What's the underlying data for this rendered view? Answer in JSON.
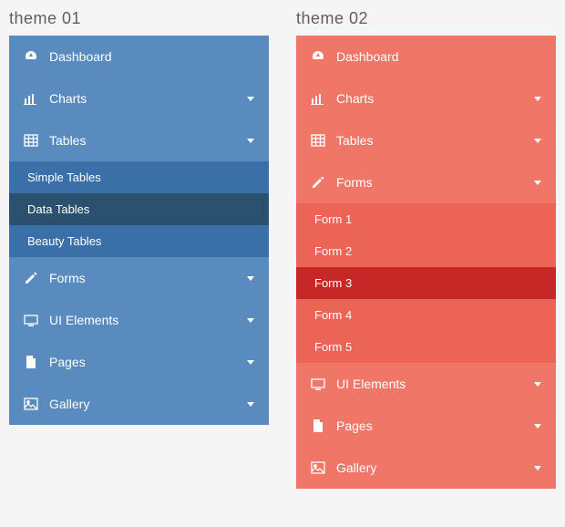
{
  "themes": [
    {
      "id": "theme-01",
      "title": "theme 01",
      "color": "blue",
      "items": [
        {
          "icon": "dashboard",
          "label": "Dashboard",
          "children": false
        },
        {
          "icon": "charts",
          "label": "Charts",
          "children": true
        },
        {
          "icon": "tables",
          "label": "Tables",
          "children": true,
          "sub": [
            {
              "label": "Simple Tables",
              "active": false
            },
            {
              "label": "Data Tables",
              "active": true
            },
            {
              "label": "Beauty Tables",
              "active": false
            }
          ]
        },
        {
          "icon": "forms",
          "label": "Forms",
          "children": true
        },
        {
          "icon": "ui",
          "label": "UI Elements",
          "children": true
        },
        {
          "icon": "pages",
          "label": "Pages",
          "children": true
        },
        {
          "icon": "gallery",
          "label": "Gallery",
          "children": true
        }
      ]
    },
    {
      "id": "theme-02",
      "title": "theme 02",
      "color": "red",
      "items": [
        {
          "icon": "dashboard",
          "label": "Dashboard",
          "children": false
        },
        {
          "icon": "charts",
          "label": "Charts",
          "children": true
        },
        {
          "icon": "tables",
          "label": "Tables",
          "children": true
        },
        {
          "icon": "forms",
          "label": "Forms",
          "children": true,
          "sub": [
            {
              "label": "Form 1",
              "active": false
            },
            {
              "label": "Form 2",
              "active": false
            },
            {
              "label": "Form 3",
              "active": true
            },
            {
              "label": "Form 4",
              "active": false
            },
            {
              "label": "Form 5",
              "active": false
            }
          ]
        },
        {
          "icon": "ui",
          "label": "UI Elements",
          "children": true
        },
        {
          "icon": "pages",
          "label": "Pages",
          "children": true
        },
        {
          "icon": "gallery",
          "label": "Gallery",
          "children": true
        }
      ]
    }
  ]
}
